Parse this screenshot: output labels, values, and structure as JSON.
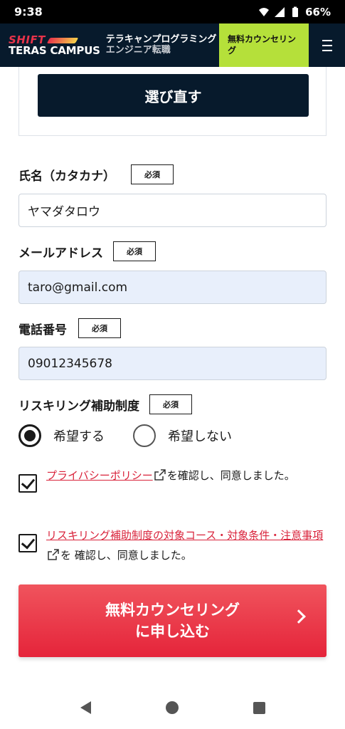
{
  "status_bar": {
    "time": "9:38",
    "battery": "66%"
  },
  "header": {
    "brand_shift": "SHIFT",
    "brand_teras": "TERAS CAMPUS",
    "tagline_line1": "テラキャンプログラミング",
    "tagline_line2": "エンジニア転職",
    "counsel_button": "無料カウンセリング",
    "menu_icon": "hamburger-icon"
  },
  "card": {
    "reselect_button": "選び直す"
  },
  "form": {
    "name": {
      "label": "氏名（カタカナ）",
      "required": "必須",
      "value": "ヤマダタロウ"
    },
    "email": {
      "label": "メールアドレス",
      "required": "必須",
      "value": "taro@gmail.com"
    },
    "phone": {
      "label": "電話番号",
      "required": "必須",
      "value": "09012345678"
    },
    "reskilling": {
      "label": "リスキリング補助制度",
      "required": "必須",
      "options": [
        "希望する",
        "希望しない"
      ],
      "selected": "希望する"
    }
  },
  "consent": {
    "privacy_link": "プライバシーポリシー",
    "privacy_suffix": "を確認し、同意しました。",
    "terms_link": "リスキリング補助制度の対象コース・対象条件・注意事項",
    "terms_suffix": "を 確認し、同意しました。"
  },
  "submit": {
    "line1": "無料カウンセリング",
    "line2": "に申し込む"
  },
  "colors": {
    "header_bg": "#071a2c",
    "accent_green": "#b5e03a",
    "accent_red": "#e5243a",
    "input_filled_bg": "#e8effb"
  }
}
